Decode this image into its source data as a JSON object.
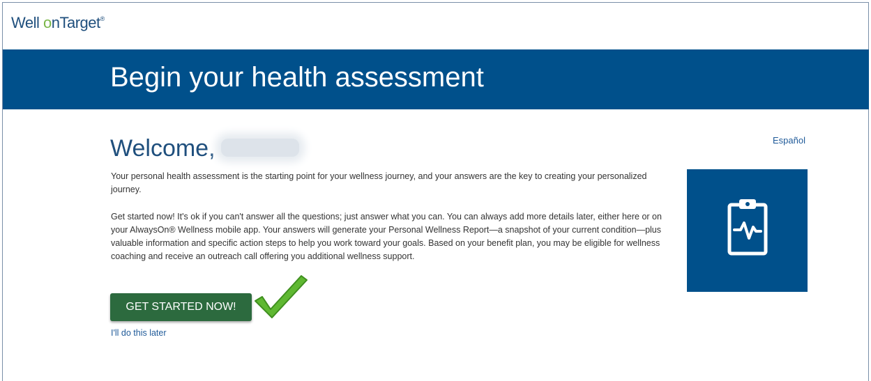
{
  "header": {
    "logo_well": "Well ",
    "logo_on_o": "o",
    "logo_on_n": "n",
    "logo_target": "Target",
    "logo_reg": "®"
  },
  "banner": {
    "title": "Begin your health assessment"
  },
  "main": {
    "welcome_label": "Welcome,",
    "language_link": "Español",
    "paragraph1": "Your personal health assessment is the starting point for your wellness journey, and your answers are the key to creating your personalized journey.",
    "paragraph2": "Get started now! It's ok if you can't answer all the questions; just answer what you can. You can always add more details later, either here or on your AlwaysOn® Wellness mobile app. Your answers will generate your Personal Wellness Report—a snapshot of your current condition—plus valuable information and specific action steps to help you work toward your goals. Based on your benefit plan, you may be eligible for wellness coaching and receive an outreach call offering you additional wellness support.",
    "cta_label": "GET STARTED NOW!",
    "later_link": "I'll do this later"
  },
  "icons": {
    "tile": "clipboard-heartbeat-icon",
    "annotation": "green-checkmark-icon"
  },
  "colors": {
    "brand_blue": "#00508b",
    "cta_green": "#2c6a3e",
    "check_green": "#5fb832",
    "link_blue": "#1f5a99"
  }
}
